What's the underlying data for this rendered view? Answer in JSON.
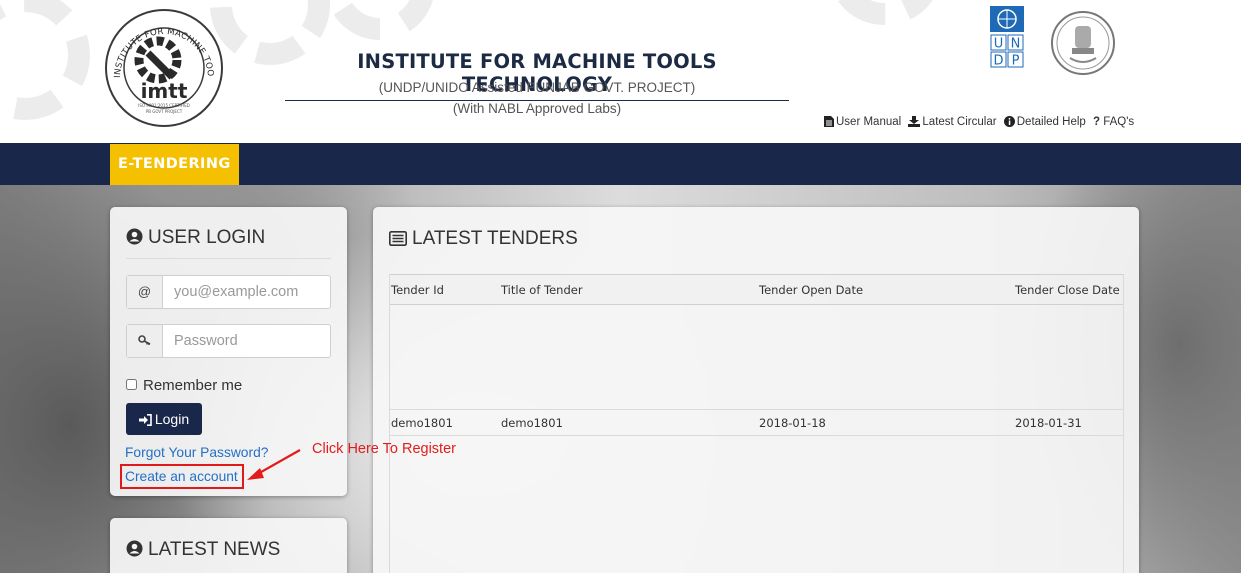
{
  "header": {
    "title": "INSTITUTE FOR MACHINE TOOLS TECHNOLOGY",
    "subtitle_line1": "(UNDP/UNIDO Assisted PUNJAB GOVT. PROJECT)",
    "subtitle_line2": "(With NABL Approved Labs)",
    "logo": {
      "ring_text": "INSTITUTE FOR MACHINE TOOLS TECHNOLOGY",
      "wordmark": "imtt",
      "small_text1": "ISO 9001:2015 CERTIFIED",
      "small_text2": "PB GOVT PROJECT"
    },
    "undp_logo_letters": [
      "U",
      "N",
      "D",
      "P"
    ],
    "links": [
      {
        "label": "User Manual",
        "icon": "file-icon"
      },
      {
        "label": "Latest Circular",
        "icon": "download-icon"
      },
      {
        "label": "Detailed Help",
        "icon": "info-circle-icon"
      },
      {
        "label": "FAQ's",
        "icon": "question-icon"
      }
    ]
  },
  "nav": {
    "brand": "E-TENDERING"
  },
  "login": {
    "title": "USER LOGIN",
    "email_addon": "@",
    "email_placeholder": "you@example.com",
    "password_placeholder": "Password",
    "remember_label": "Remember me",
    "login_button": "Login",
    "forgot_link": "Forgot Your Password?",
    "create_link": "Create an account"
  },
  "news": {
    "title": "LATEST NEWS"
  },
  "tenders": {
    "title": "LATEST TENDERS",
    "columns": [
      "Tender Id",
      "Title of Tender",
      "Tender Open Date",
      "Tender Close Date"
    ],
    "rows": [
      [
        "demo1801",
        "demo1801",
        "2018-01-18",
        "2018-01-31"
      ]
    ]
  },
  "annotation": {
    "text": "Click Here To Register",
    "color": "#e41b1b"
  },
  "colors": {
    "navbar": "#19274a",
    "brand": "#f5c000",
    "link": "#2470c4",
    "login_button": "#19274a"
  }
}
